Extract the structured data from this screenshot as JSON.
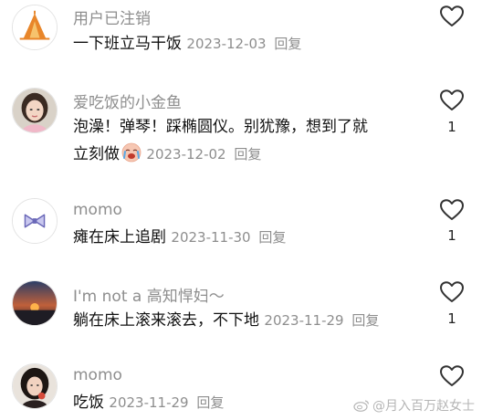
{
  "comments": [
    {
      "username": "用户已注销",
      "text": "一下班立马干饭",
      "date": "2023-12-03",
      "reply": "回复",
      "likes": "",
      "avatar": "tent-icon"
    },
    {
      "username": "爱吃饭的小金鱼",
      "text_line1": "泡澡！弹琴！踩椭圆仪。别犹豫，想到了就",
      "text_line2": "立刻做",
      "emoji": "crying-face-emoji",
      "date": "2023-12-02",
      "reply": "回复",
      "likes": "1",
      "avatar": "girl-photo"
    },
    {
      "username": "momo",
      "text": "瘫在床上追剧",
      "date": "2023-11-30",
      "reply": "回复",
      "likes": "1",
      "avatar": "bow-icon"
    },
    {
      "username": "I'm not a 高知悍妇～",
      "text": "躺在床上滚来滚去，不下地",
      "date": "2023-11-29",
      "reply": "回复",
      "likes": "1",
      "avatar": "sunset-photo"
    },
    {
      "username": "momo",
      "text": "吃饭",
      "date": "2023-11-29",
      "reply": "回复",
      "likes": "",
      "avatar": "woman-photo"
    }
  ],
  "watermark": "@月入百万赵女士",
  "colors": {
    "username": "#8e8e8e",
    "text": "#111111",
    "meta": "#8e8e8e"
  }
}
